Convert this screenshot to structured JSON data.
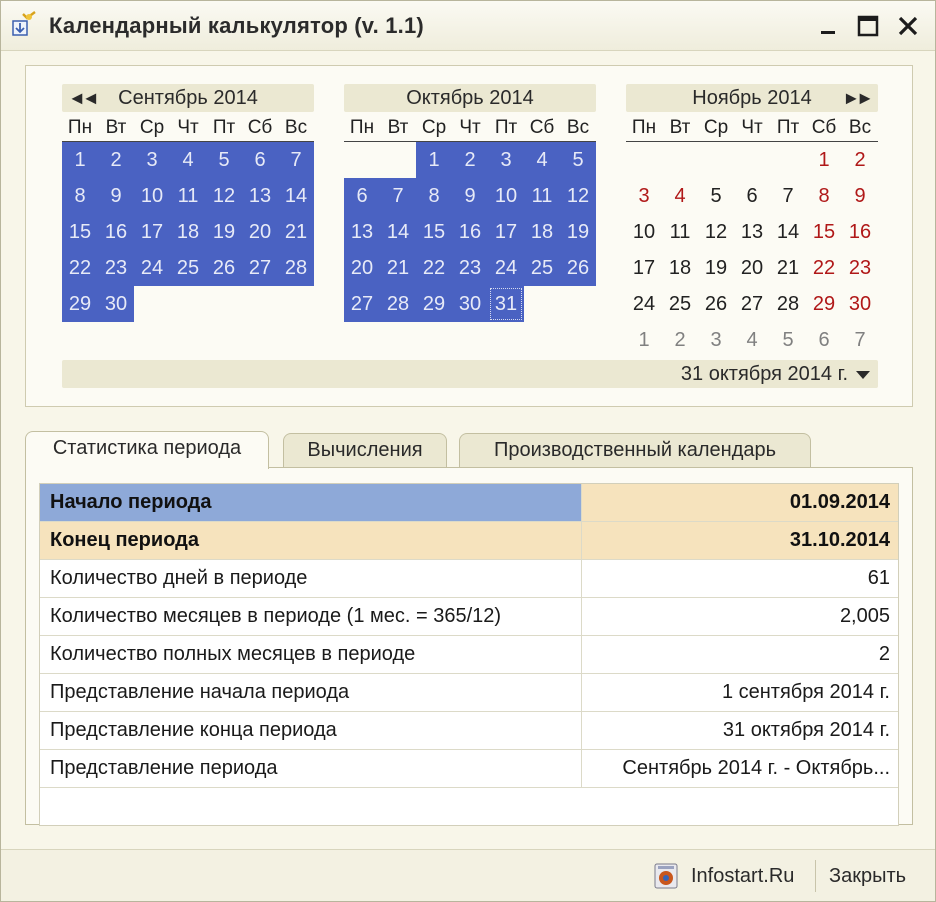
{
  "window": {
    "title": "Календарный калькулятор (v. 1.1)"
  },
  "calendar": {
    "weekdays": [
      "Пн",
      "Вт",
      "Ср",
      "Чт",
      "Пт",
      "Сб",
      "Вс"
    ],
    "nav_prev": "◄◄",
    "nav_next": "►►",
    "months": [
      {
        "title": "Сентябрь 2014",
        "weeks": [
          [
            "1",
            "2",
            "3",
            "4",
            "5",
            "6",
            "7"
          ],
          [
            "8",
            "9",
            "10",
            "11",
            "12",
            "13",
            "14"
          ],
          [
            "15",
            "16",
            "17",
            "18",
            "19",
            "20",
            "21"
          ],
          [
            "22",
            "23",
            "24",
            "25",
            "26",
            "27",
            "28"
          ],
          [
            "29",
            "30",
            "",
            "",
            "",
            "",
            ""
          ]
        ]
      },
      {
        "title": "Октябрь 2014",
        "weeks": [
          [
            "",
            "",
            "1",
            "2",
            "3",
            "4",
            "5"
          ],
          [
            "6",
            "7",
            "8",
            "9",
            "10",
            "11",
            "12"
          ],
          [
            "13",
            "14",
            "15",
            "16",
            "17",
            "18",
            "19"
          ],
          [
            "20",
            "21",
            "22",
            "23",
            "24",
            "25",
            "26"
          ],
          [
            "27",
            "28",
            "29",
            "30",
            "31",
            "",
            ""
          ]
        ]
      },
      {
        "title": "Ноябрь 2014",
        "weeks": [
          [
            "",
            "",
            "",
            "",
            "",
            "1",
            "2"
          ],
          [
            "3",
            "4",
            "5",
            "6",
            "7",
            "8",
            "9"
          ],
          [
            "10",
            "11",
            "12",
            "13",
            "14",
            "15",
            "16"
          ],
          [
            "17",
            "18",
            "19",
            "20",
            "21",
            "22",
            "23"
          ],
          [
            "24",
            "25",
            "26",
            "27",
            "28",
            "29",
            "30"
          ],
          [
            "1",
            "2",
            "3",
            "4",
            "5",
            "6",
            "7"
          ]
        ]
      }
    ],
    "selected_date_text": "31 октября 2014 г.",
    "colors": {
      "selection": "#4a62c2",
      "holiday": "#b01818",
      "other_month": "#808080"
    }
  },
  "tabs": [
    {
      "label": "Статистика периода",
      "active": true
    },
    {
      "label": "Вычисления",
      "active": false
    },
    {
      "label": "Производственный календарь",
      "active": false
    }
  ],
  "stats": {
    "rows": [
      {
        "label": "Начало периода",
        "value": "01.09.2014"
      },
      {
        "label": "Конец периода",
        "value": "31.10.2014"
      },
      {
        "label": "Количество дней в периоде",
        "value": "61"
      },
      {
        "label": "Количество месяцев в периоде (1 мес. = 365/12)",
        "value": "2,005"
      },
      {
        "label": "Количество полных месяцев в периоде",
        "value": "2"
      },
      {
        "label": "Представление начала периода",
        "value": "1 сентября 2014 г."
      },
      {
        "label": "Представление конца периода",
        "value": "31 октября 2014 г."
      },
      {
        "label": "Представление периода",
        "value": "Сентябрь 2014 г. - Октябрь..."
      }
    ]
  },
  "footer": {
    "infostart_label": "Infostart.Ru",
    "close_label": "Закрыть"
  }
}
